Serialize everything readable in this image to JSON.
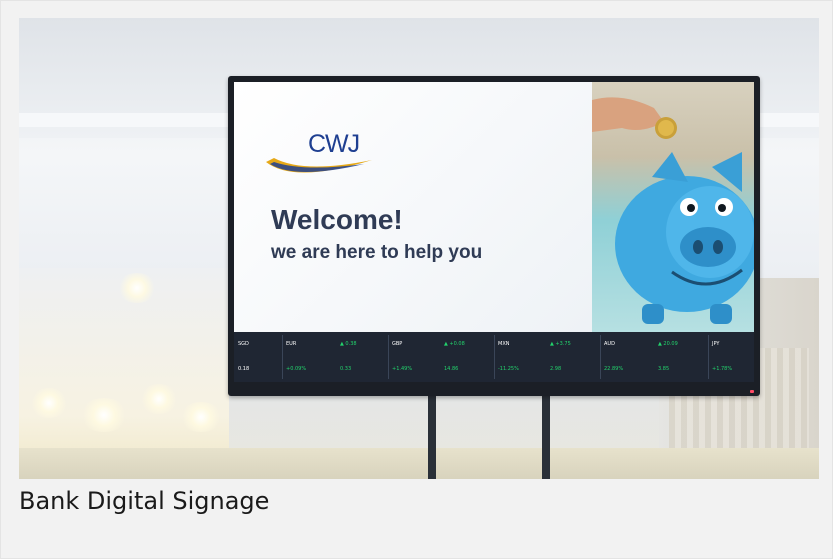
{
  "caption": "Bank Digital Signage",
  "signage": {
    "logo_text": "CWJ",
    "welcome": "Welcome!",
    "tagline": "we are here to help you"
  },
  "colors": {
    "brand_blue": "#1e3f91",
    "brand_gold": "#e6a817",
    "ticker_bg": "#1f2633",
    "ticker_up": "#22d36c"
  },
  "icons": {
    "up": "▲"
  },
  "ticker": [
    [
      "SGD",
      "0.18"
    ],
    [
      "EUR",
      "▲ 0.38",
      "+0.09%",
      "0.33"
    ],
    [
      "GBP",
      "▲ +0.08",
      "+1.49%",
      "14.86"
    ],
    [
      "MXN",
      "▲ +3.75",
      "-11.25%",
      "2.98"
    ],
    [
      "AUD",
      "▲ 20.09",
      "22.89%",
      "3.85"
    ],
    [
      "JPY",
      "+1.78%"
    ]
  ]
}
